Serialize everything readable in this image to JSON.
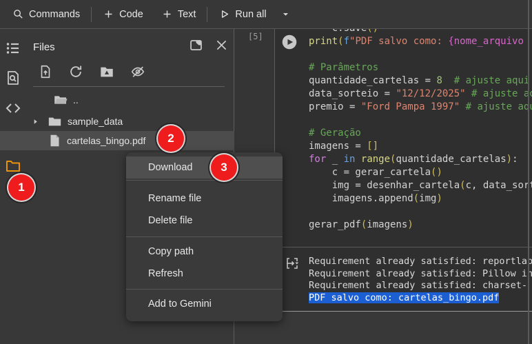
{
  "toolbar": {
    "commands_label": "Commands",
    "add_code_label": "Code",
    "add_text_label": "Text",
    "run_all_label": "Run all"
  },
  "files_panel": {
    "title": "Files",
    "tree": [
      {
        "name": "..",
        "type": "parent-folder"
      },
      {
        "name": "sample_data",
        "type": "folder",
        "expandable": true
      },
      {
        "name": "cartelas_bingo.pdf",
        "type": "file",
        "selected": true
      }
    ]
  },
  "context_menu": {
    "items": [
      {
        "label": "Download",
        "highlighted": true
      },
      {
        "label": "Rename file"
      },
      {
        "label": "Delete file"
      },
      {
        "label": "Copy path"
      },
      {
        "label": "Refresh"
      },
      {
        "label": "Add to Gemini"
      }
    ]
  },
  "annotations": [
    {
      "label": "1"
    },
    {
      "label": "2"
    },
    {
      "label": "3"
    }
  ],
  "code_cell": {
    "execution_count": "[5]",
    "lines": [
      [
        [
          "p",
          "    c.save"
        ],
        [
          "y",
          "()"
        ]
      ],
      [
        [
          "f",
          "print"
        ],
        [
          "y",
          "("
        ],
        [
          "b",
          "f"
        ],
        [
          "s",
          "\"PDF salvo como: "
        ],
        [
          "m",
          "{nome_arquivo"
        ]
      ],
      [],
      [
        [
          "c",
          "# Parâmetros"
        ]
      ],
      [
        [
          "p",
          "quantidade_cartelas = "
        ],
        [
          "n",
          "8"
        ],
        [
          "p",
          "  "
        ],
        [
          "c",
          "# ajuste aqui"
        ]
      ],
      [
        [
          "p",
          "data_sorteio = "
        ],
        [
          "s",
          "\"12/12/2025\""
        ],
        [
          "p",
          " "
        ],
        [
          "c",
          "# ajuste aqui"
        ]
      ],
      [
        [
          "p",
          "premio = "
        ],
        [
          "s",
          "\"Ford Pampa 1997\""
        ],
        [
          "p",
          " "
        ],
        [
          "c",
          "# ajuste aqui"
        ]
      ],
      [],
      [
        [
          "c",
          "# Geração"
        ]
      ],
      [
        [
          "p",
          "imagens = "
        ],
        [
          "y",
          "[]"
        ]
      ],
      [
        [
          "k",
          "for"
        ],
        [
          "p",
          " _ "
        ],
        [
          "o",
          "in"
        ],
        [
          "p",
          " "
        ],
        [
          "f",
          "range"
        ],
        [
          "y",
          "("
        ],
        [
          "p",
          "quantidade_cartelas"
        ],
        [
          "y",
          ")"
        ],
        [
          "p",
          ":"
        ]
      ],
      [
        [
          "p",
          "    c = gerar_cartela"
        ],
        [
          "y",
          "()"
        ]
      ],
      [
        [
          "p",
          "    img = desenhar_cartela"
        ],
        [
          "y",
          "("
        ],
        [
          "p",
          "c, data_sorteio"
        ]
      ],
      [
        [
          "p",
          "    imagens.append"
        ],
        [
          "y",
          "("
        ],
        [
          "p",
          "img"
        ],
        [
          "y",
          ")"
        ]
      ],
      [],
      [
        [
          "p",
          "gerar_pdf"
        ],
        [
          "y",
          "("
        ],
        [
          "p",
          "imagens"
        ],
        [
          "y",
          ")"
        ]
      ]
    ]
  },
  "output_cell": {
    "lines": [
      {
        "text": "Requirement already satisfied: reportlab",
        "highlighted": false
      },
      {
        "text": "Requirement already satisfied: Pillow in",
        "highlighted": false
      },
      {
        "text": "Requirement already satisfied: charset-",
        "highlighted": false
      },
      {
        "text": "PDF salvo como: cartelas_bingo.pdf",
        "highlighted": true
      }
    ]
  },
  "colors": {
    "annotation_red": "#ee1c1c",
    "selection_blue": "#1b5fd2",
    "active_rail_orange": "#e8910a",
    "cell_background": "#2f2f2f",
    "panel_background": "#383838"
  },
  "icons": {
    "search-icon": "magnifier",
    "plus-icon": "plus",
    "run-all-icon": "play-outline",
    "dropdown-caret-icon": "caret-down",
    "toc-icon": "bulleted-list",
    "find-replace-icon": "document-magnifier",
    "code-snippets-icon": "angle-brackets",
    "secrets-icon": "key",
    "files-icon": "folder",
    "open-in-tab-icon": "window",
    "close-icon": "x",
    "upload-file-icon": "document-up-arrow",
    "refresh-icon": "circular-arrow",
    "mount-drive-icon": "drive-folder",
    "hidden-files-icon": "eye-slash",
    "chevron-right-icon": "triangle-right",
    "parent-folder-icon": "open-folder",
    "folder-icon": "folder",
    "file-icon": "page",
    "run-cell-icon": "play-circle",
    "output-icon": "arrow-into-brackets"
  }
}
